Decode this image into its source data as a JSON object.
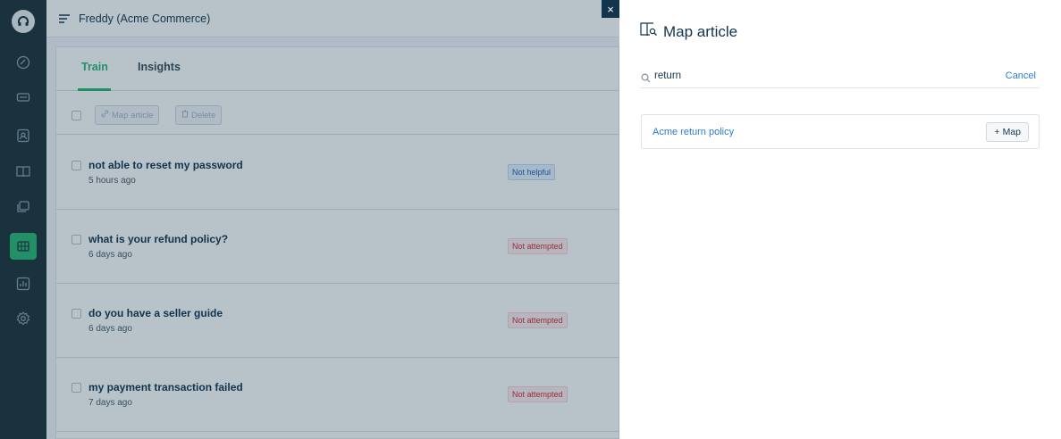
{
  "app": {
    "title": "Freddy (Acme Commerce)"
  },
  "colors": {
    "accent": "#2bb673",
    "rail": "#1f3039",
    "link": "#2c7cd1"
  },
  "rail": {
    "items": [
      {
        "icon": "headset-logo-icon"
      },
      {
        "icon": "dashboard-icon"
      },
      {
        "icon": "tickets-icon"
      },
      {
        "icon": "contacts-icon"
      },
      {
        "icon": "knowledge-base-icon"
      },
      {
        "icon": "canned-responses-icon"
      },
      {
        "icon": "bot-icon",
        "active": true
      },
      {
        "icon": "reports-icon"
      },
      {
        "icon": "settings-icon"
      }
    ]
  },
  "tabs": [
    {
      "label": "Train",
      "active": true
    },
    {
      "label": "Insights",
      "active": false
    }
  ],
  "toolbar": {
    "map_article_label": "Map article",
    "delete_label": "Delete"
  },
  "questions": [
    {
      "text": "not able to reset my password",
      "time": "5 hours ago",
      "status": "Not helpful"
    },
    {
      "text": "what is your refund policy?",
      "time": "6 days ago",
      "status": "Not attempted"
    },
    {
      "text": "do you have a seller guide",
      "time": "6 days ago",
      "status": "Not attempted"
    },
    {
      "text": "my payment transaction failed",
      "time": "7 days ago",
      "status": "Not attempted"
    }
  ],
  "drawer": {
    "title": "Map article",
    "search_value": "return",
    "cancel_label": "Cancel",
    "close_glyph": "×",
    "results": [
      {
        "title": "Acme return policy",
        "map_label": "Map",
        "map_glyph": "+"
      }
    ]
  }
}
